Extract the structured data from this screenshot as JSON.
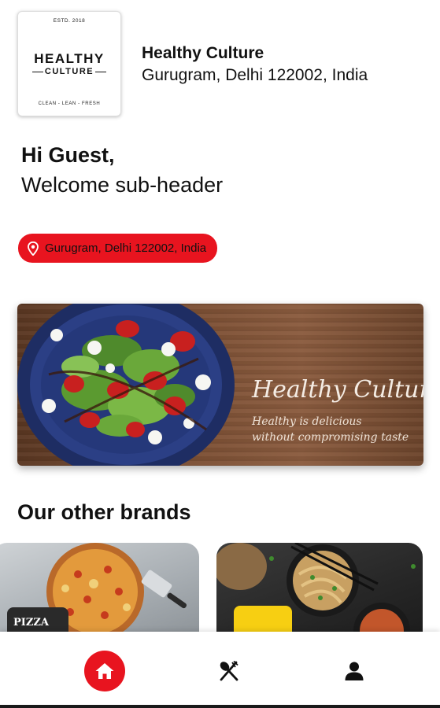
{
  "header": {
    "logo": {
      "estd": "ESTD. 2018",
      "word1": "HEALTHY",
      "word2": "CULTURE",
      "tagline": "CLEAN - LEAN - FRESH"
    },
    "shop_name": "Healthy Culture",
    "shop_address": "Gurugram, Delhi 122002, India"
  },
  "greeting": {
    "title": "Hi Guest,",
    "subtitle": "Welcome sub-header"
  },
  "location": {
    "label": "Gurugram, Delhi 122002, India",
    "icon": "location-pin-icon",
    "color": "#e8141f"
  },
  "banner": {
    "title": "Healthy Culture",
    "line1": "Healthy is delicious",
    "line2": "without compromising taste"
  },
  "brands": {
    "title": "Our other brands",
    "items": [
      {
        "badge": "PIZZA"
      },
      {
        "badge": ""
      }
    ]
  },
  "nav": {
    "items": [
      {
        "icon": "home-icon",
        "active": true
      },
      {
        "icon": "fork-spoon-icon",
        "active": false
      },
      {
        "icon": "profile-icon",
        "active": false
      }
    ],
    "accent": "#e8141f"
  }
}
